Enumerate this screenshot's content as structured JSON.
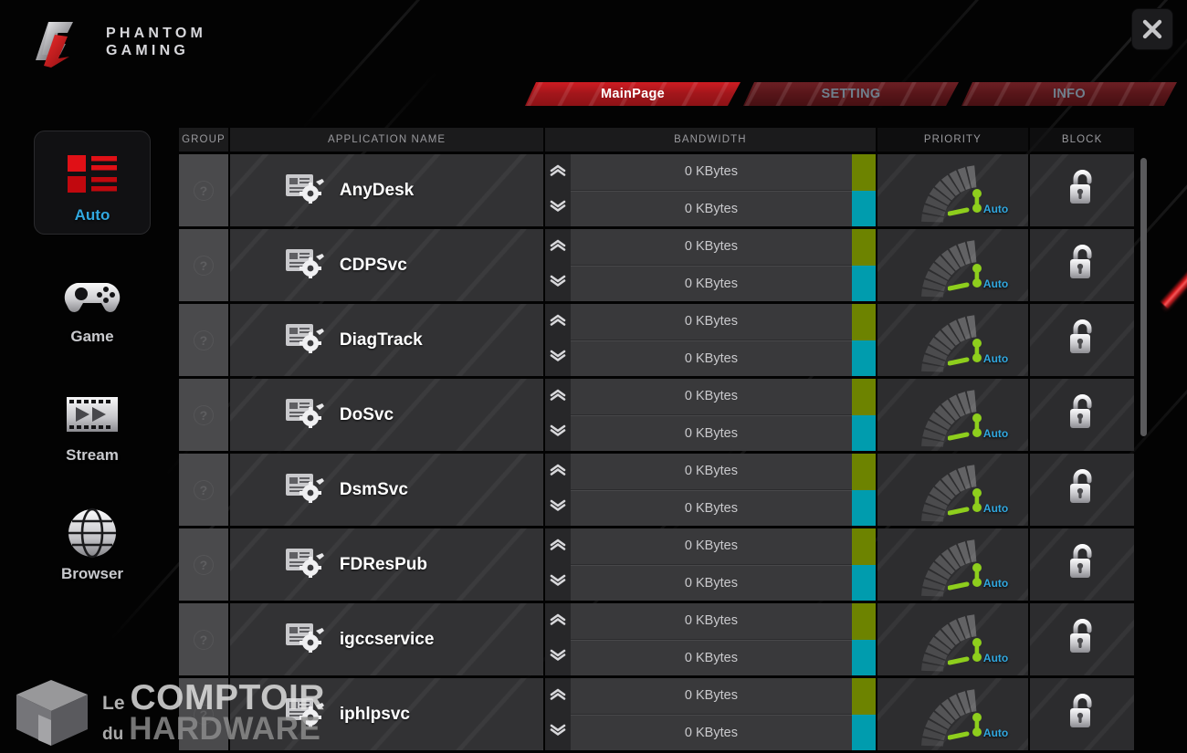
{
  "window": {
    "close_label": "close-window",
    "logo_line1": "PHANTOM",
    "logo_line2": "GAMING"
  },
  "tabs": [
    {
      "label": "MainPage",
      "active": true
    },
    {
      "label": "SETTING",
      "active": false
    },
    {
      "label": "INFO",
      "active": false
    }
  ],
  "sidebar": {
    "items": [
      {
        "label": "Auto",
        "icon": "grid-list-icon",
        "selected": true
      },
      {
        "label": "Game",
        "icon": "gamepad-icon",
        "selected": false
      },
      {
        "label": "Stream",
        "icon": "film-strip-icon",
        "selected": false
      },
      {
        "label": "Browser",
        "icon": "globe-icon",
        "selected": false
      }
    ]
  },
  "table": {
    "headers": {
      "group": "GROUP",
      "application_name": "APPLICATION NAME",
      "bandwidth": "BANDWIDTH",
      "priority": "PRIORITY",
      "block": "BLOCK"
    },
    "group_marker": "?",
    "priority_label": "Auto",
    "rows": [
      {
        "app": "AnyDesk",
        "upload": "0 KBytes",
        "download": "0 KBytes",
        "priority": "Auto",
        "blocked": false
      },
      {
        "app": "CDPSvc",
        "upload": "0 KBytes",
        "download": "0 KBytes",
        "priority": "Auto",
        "blocked": false
      },
      {
        "app": "DiagTrack",
        "upload": "0 KBytes",
        "download": "0 KBytes",
        "priority": "Auto",
        "blocked": false
      },
      {
        "app": "DoSvc",
        "upload": "0 KBytes",
        "download": "0 KBytes",
        "priority": "Auto",
        "blocked": false
      },
      {
        "app": "DsmSvc",
        "upload": "0 KBytes",
        "download": "0 KBytes",
        "priority": "Auto",
        "blocked": false
      },
      {
        "app": "FDResPub",
        "upload": "0 KBytes",
        "download": "0 KBytes",
        "priority": "Auto",
        "blocked": false
      },
      {
        "app": "igccservice",
        "upload": "0 KBytes",
        "download": "0 KBytes",
        "priority": "Auto",
        "blocked": false
      },
      {
        "app": "iphlpsvc",
        "upload": "0 KBytes",
        "download": "0 KBytes",
        "priority": "Auto",
        "blocked": false
      }
    ]
  },
  "watermark": {
    "le": "Le",
    "comptoir": "COMPTOIR",
    "du": "du",
    "hardware": "HARDWARE"
  },
  "colors": {
    "accent_red": "#c0161c",
    "accent_cyan": "#31a8e0",
    "upload_bar": "#6d8300",
    "download_bar": "#009cae",
    "gauge_green": "#8ece1d"
  }
}
